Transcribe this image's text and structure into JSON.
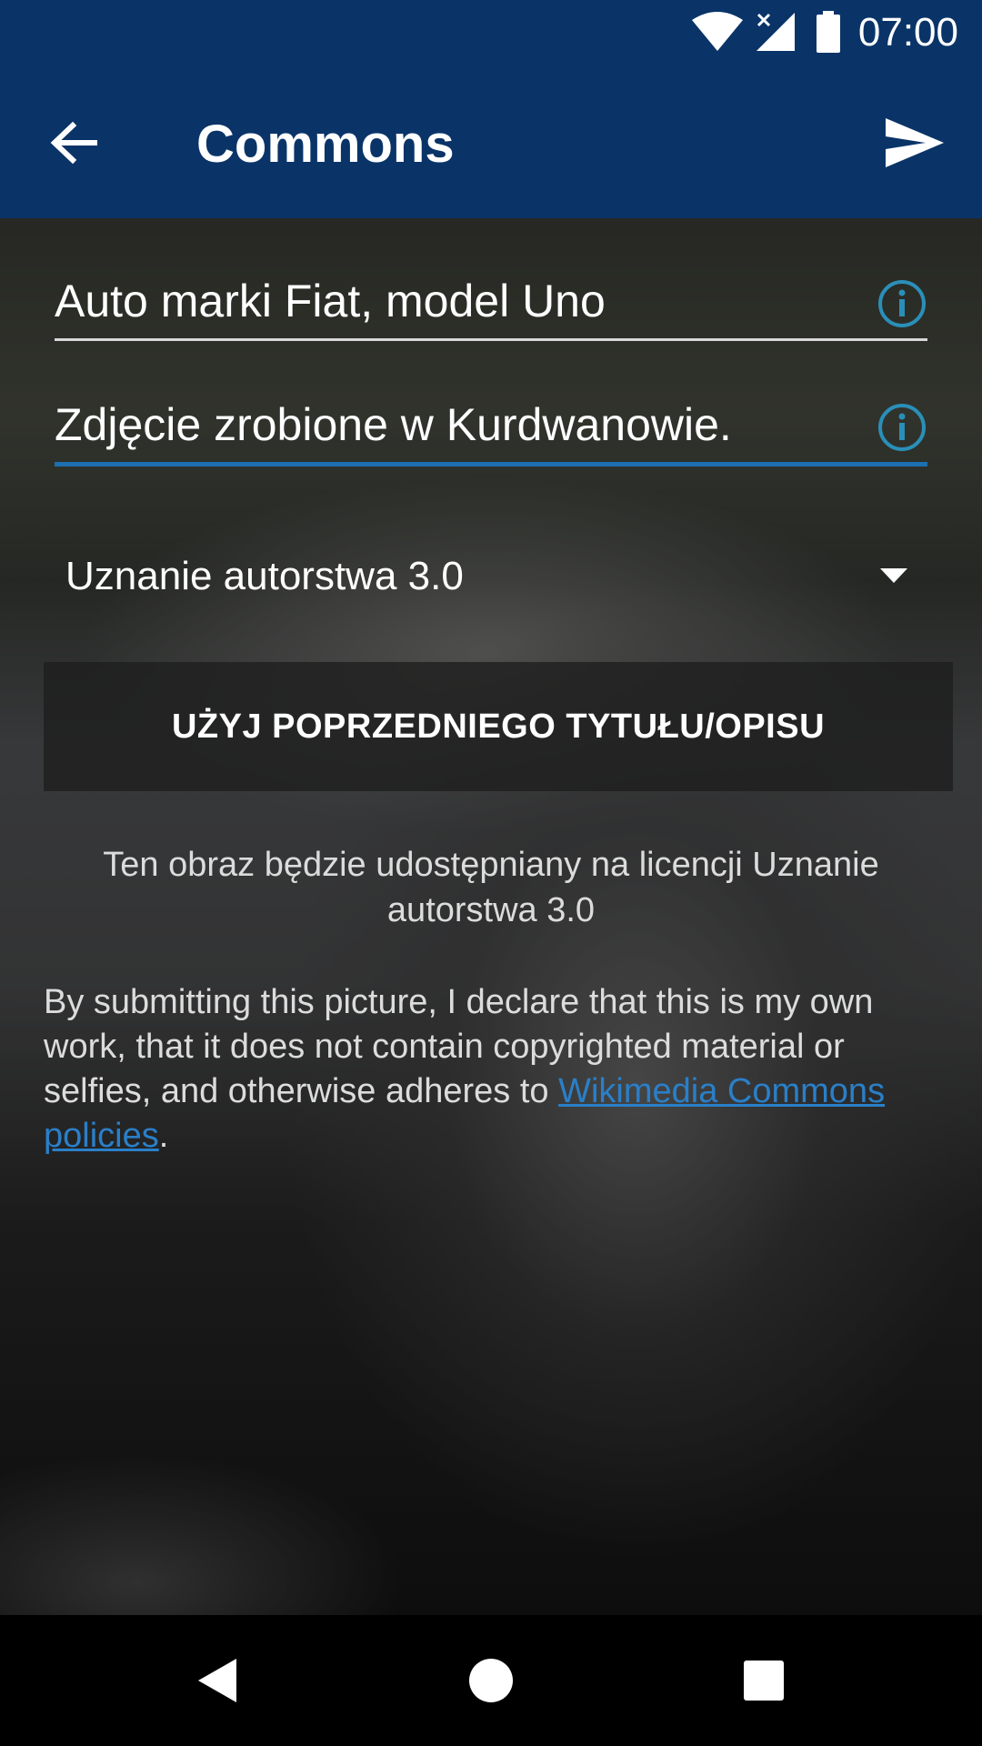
{
  "status_bar": {
    "time": "07:00",
    "icons": [
      "wifi-icon",
      "signal-no-data-icon",
      "battery-icon"
    ]
  },
  "app_bar": {
    "title": "Commons",
    "back_icon": "arrow-back-icon",
    "send_icon": "send-icon"
  },
  "form": {
    "title_value": "Auto marki Fiat, model Uno",
    "description_value": "Zdjęcie zrobione w Kurdwanowie.",
    "info_icon": "info-icon",
    "license_selected": "Uznanie autorstwa 3.0",
    "use_previous_label": "UŻYJ POPRZEDNIEGO TYTUŁU/OPISU",
    "license_note": "Ten obraz będzie udostępniany na licencji Uznanie autorstwa 3.0",
    "declaration_text": "By submitting this picture, I declare that this is my own work, that it does not contain copyrighted material or selfies, and otherwise adheres to ",
    "policies_link": "Wikimedia Commons policies",
    "declaration_end": "."
  },
  "nav_bar": {
    "icons": [
      "nav-back-icon",
      "nav-home-icon",
      "nav-recents-icon"
    ]
  },
  "colors": {
    "primary": "#0a3468",
    "accent": "#1e6fb0",
    "info_icon": "#2a8fb8",
    "link": "#2a7fc8"
  }
}
